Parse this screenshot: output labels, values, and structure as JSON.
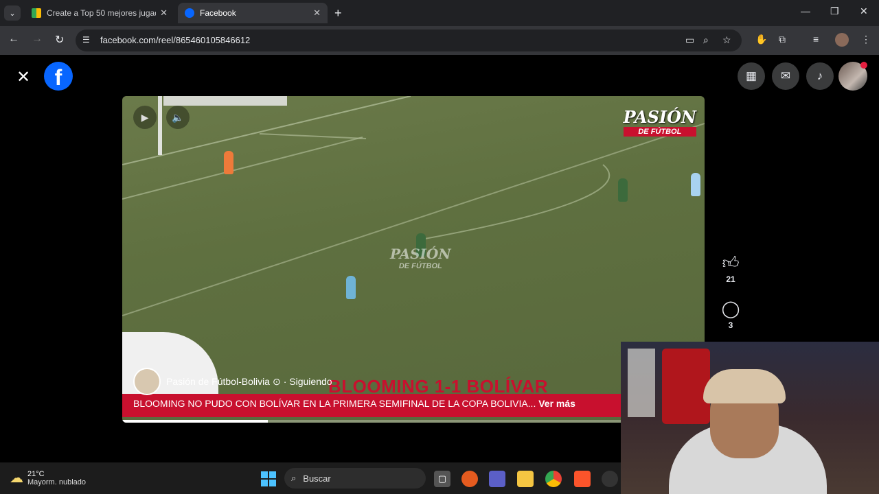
{
  "browser": {
    "tabs": [
      {
        "title": "Create a Top 50 mejores jugado",
        "active": false
      },
      {
        "title": "Facebook",
        "active": true
      }
    ],
    "url": "facebook.com/reel/865460105846612",
    "new_tab": "+",
    "tab_close": "✕"
  },
  "facebook": {
    "close_icon": "✕",
    "logo": "f",
    "author": "Pasión de Fútbol-Bolivia",
    "follow_status": "· Siguiendo",
    "caption": "BLOOMING NO PUDO CON BOLÍVAR EN LA PRIMERA SEMIFINAL DE LA COPA BOLIVIA...",
    "see_more": "Ver más",
    "likes": "21",
    "comments": "3",
    "progress": 0.25
  },
  "video_overlay": {
    "brand_top": "PASIÓN",
    "brand_sub": "DE FÚTBOL",
    "watermark_top": "PASIÓN",
    "watermark_sub": "DE FÚTBOL",
    "headline": "BLOOMING 1-1 BOLÍVAR"
  },
  "taskbar": {
    "temperature": "21°C",
    "weather": "Mayorm. nublado",
    "search_placeholder": "Buscar"
  },
  "colors": {
    "facebook_blue": "#0866ff",
    "banner_red": "#c8102e",
    "notification_red": "#e41e3f"
  }
}
